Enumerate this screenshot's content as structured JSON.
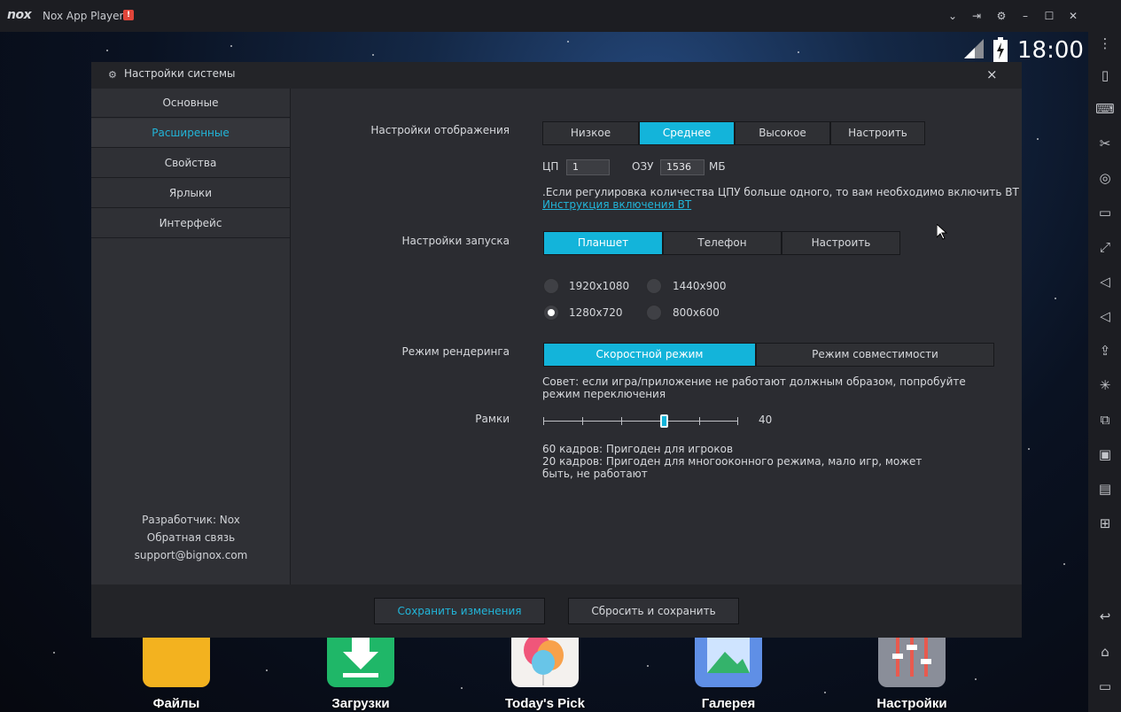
{
  "window": {
    "logo": "nox",
    "title": "Nox App Player",
    "alert_badge": "!"
  },
  "titlebar_icons": [
    "chevron-down-icon",
    "pin-icon",
    "gear-icon",
    "minimize-icon",
    "maximize-icon",
    "close-icon"
  ],
  "statusbar": {
    "time": "18:00"
  },
  "dialog": {
    "title": "Настройки системы",
    "close_glyph": "×",
    "sidebar": {
      "items": [
        {
          "label": "Основные",
          "active": false
        },
        {
          "label": "Расширенные",
          "active": true
        },
        {
          "label": "Свойства",
          "active": false
        },
        {
          "label": "Ярлыки",
          "active": false
        },
        {
          "label": "Интерфейс",
          "active": false
        }
      ],
      "developer": "Разработчик: Nox",
      "feedback": "Обратная связь",
      "email": "support@bignox.com"
    },
    "display": {
      "label": "Настройки отображения",
      "options": [
        "Низкое",
        "Среднее",
        "Высокое",
        "Настроить"
      ],
      "selected": "Среднее",
      "cpu_label": "ЦП",
      "cpu_value": "1",
      "ram_label": "ОЗУ",
      "ram_value": "1536",
      "ram_unit": "МБ",
      "vt_note": ".Если регулировка количества ЦПУ больше одного, то вам необходимо включить BT",
      "vt_link": "Инструкция включения BT"
    },
    "startup": {
      "label": "Настройки запуска",
      "options": [
        "Планшет",
        "Телефон",
        "Настроить"
      ],
      "selected": "Планшет",
      "resolutions": [
        "1920x1080",
        "1440x900",
        "1280x720",
        "800x600"
      ],
      "selected_resolution": "1280x720"
    },
    "rendering": {
      "label": "Режим рендеринга",
      "options": [
        "Скоростной режим",
        "Режим совместимости"
      ],
      "selected": "Скоростной режим",
      "tip": "Совет: если игра/приложение не работают должным образом, попробуйте режим переключения"
    },
    "frames": {
      "label": "Рамки",
      "value": "40",
      "slider_fraction": 0.625,
      "note1": "60 кадров: Пригоден для игроков",
      "note2": "20 кадров: Пригоден для многооконного режима, мало игр, может быть, не работают"
    },
    "footer": {
      "save": "Сохранить изменения",
      "reset": "Сбросить и сохранить"
    }
  },
  "dock": [
    {
      "label": "Файлы",
      "icon": "folder-icon"
    },
    {
      "label": "Загрузки",
      "icon": "download-icon"
    },
    {
      "label": "Today's Pick",
      "icon": "balloon-icon"
    },
    {
      "label": "Галерея",
      "icon": "gallery-icon"
    },
    {
      "label": "Настройки",
      "icon": "settings-sliders-icon"
    }
  ],
  "right_toolbar": [
    "more-icon",
    "rotate-icon",
    "keyboard-icon",
    "scissors-icon",
    "location-icon",
    "screen-icon",
    "fullscreen-icon",
    "volume-up-icon",
    "volume-down-icon",
    "apk-install-icon",
    "shake-icon",
    "multi-instance-icon",
    "record-icon",
    "toolbox-icon",
    "add-icon",
    "back-icon",
    "home-icon",
    "recents-icon"
  ],
  "colors": {
    "accent": "#13b4da",
    "link": "#22b5d9",
    "dialog_bg": "#2b2c31",
    "titlebar_bg": "#1c1d22"
  }
}
